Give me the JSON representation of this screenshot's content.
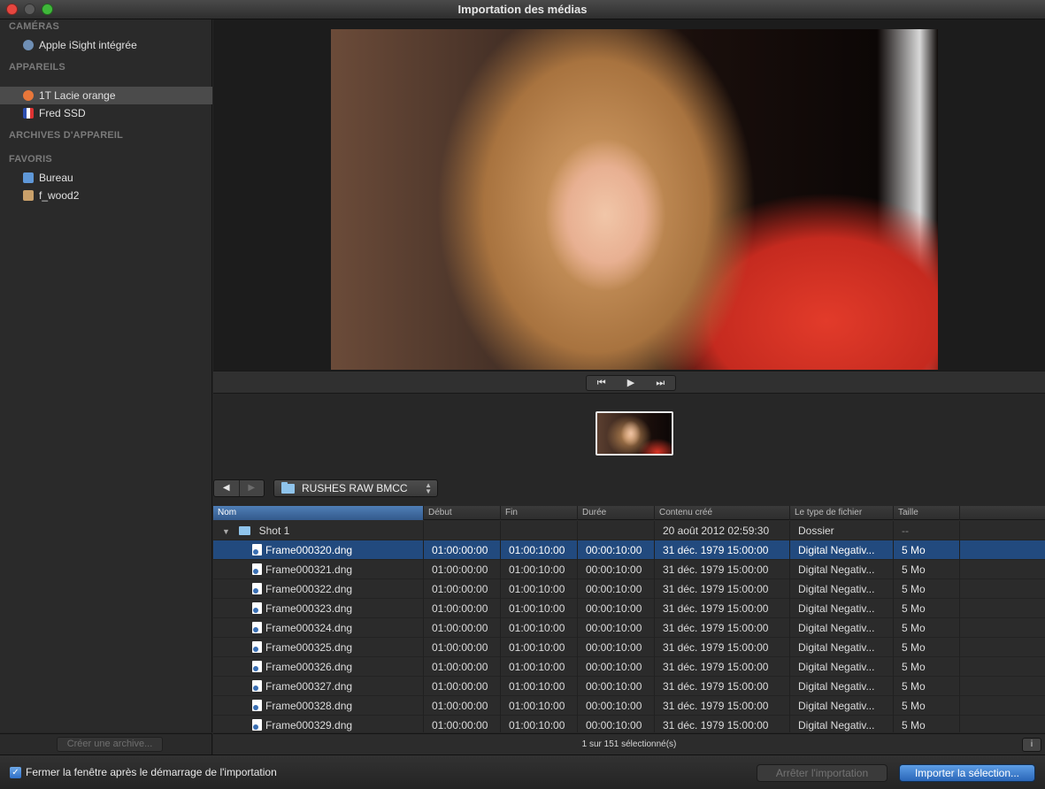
{
  "window": {
    "title": "Importation des médias"
  },
  "sidebar": {
    "sections": [
      {
        "heading": "CAMÉRAS",
        "items": [
          {
            "label": "Apple iSight intégrée",
            "icon": "camera-icon"
          }
        ]
      },
      {
        "heading": "APPAREILS",
        "items": [
          {
            "label": "1T Lacie orange",
            "icon": "drive-icon",
            "selected": true
          },
          {
            "label": "Fred SSD",
            "icon": "french-flag-icon"
          }
        ]
      },
      {
        "heading": "ARCHIVES D'APPAREIL",
        "items": []
      },
      {
        "heading": "FAVORIS",
        "items": [
          {
            "label": "Bureau",
            "icon": "desktop-folder-icon"
          },
          {
            "label": "f_wood2",
            "icon": "home-icon"
          }
        ]
      }
    ],
    "create_archive_label": "Créer une archive..."
  },
  "transport": {
    "prev": "⏮",
    "play": "▶",
    "next": "⏭"
  },
  "path": {
    "back": "◀",
    "forward": "▶",
    "folder": "RUSHES RAW BMCC"
  },
  "table": {
    "columns": [
      "Nom",
      "Début",
      "Fin",
      "Durée",
      "Contenu créé",
      "Le type de fichier",
      "Taille"
    ],
    "group": {
      "name": "Shot 1",
      "created": "20 août 2012 02:59:30",
      "type": "Dossier",
      "size": "--"
    },
    "rows": [
      {
        "name": "Frame000320.dng",
        "start": "01:00:00:00",
        "end": "01:00:10:00",
        "duration": "00:00:10:00",
        "created": "31 déc. 1979 15:00:00",
        "type": "Digital Negativ...",
        "size": "5 Mo",
        "selected": true
      },
      {
        "name": "Frame000321.dng",
        "start": "01:00:00:00",
        "end": "01:00:10:00",
        "duration": "00:00:10:00",
        "created": "31 déc. 1979 15:00:00",
        "type": "Digital Negativ...",
        "size": "5 Mo"
      },
      {
        "name": "Frame000322.dng",
        "start": "01:00:00:00",
        "end": "01:00:10:00",
        "duration": "00:00:10:00",
        "created": "31 déc. 1979 15:00:00",
        "type": "Digital Negativ...",
        "size": "5 Mo"
      },
      {
        "name": "Frame000323.dng",
        "start": "01:00:00:00",
        "end": "01:00:10:00",
        "duration": "00:00:10:00",
        "created": "31 déc. 1979 15:00:00",
        "type": "Digital Negativ...",
        "size": "5 Mo"
      },
      {
        "name": "Frame000324.dng",
        "start": "01:00:00:00",
        "end": "01:00:10:00",
        "duration": "00:00:10:00",
        "created": "31 déc. 1979 15:00:00",
        "type": "Digital Negativ...",
        "size": "5 Mo"
      },
      {
        "name": "Frame000325.dng",
        "start": "01:00:00:00",
        "end": "01:00:10:00",
        "duration": "00:00:10:00",
        "created": "31 déc. 1979 15:00:00",
        "type": "Digital Negativ...",
        "size": "5 Mo"
      },
      {
        "name": "Frame000326.dng",
        "start": "01:00:00:00",
        "end": "01:00:10:00",
        "duration": "00:00:10:00",
        "created": "31 déc. 1979 15:00:00",
        "type": "Digital Negativ...",
        "size": "5 Mo"
      },
      {
        "name": "Frame000327.dng",
        "start": "01:00:00:00",
        "end": "01:00:10:00",
        "duration": "00:00:10:00",
        "created": "31 déc. 1979 15:00:00",
        "type": "Digital Negativ...",
        "size": "5 Mo"
      },
      {
        "name": "Frame000328.dng",
        "start": "01:00:00:00",
        "end": "01:00:10:00",
        "duration": "00:00:10:00",
        "created": "31 déc. 1979 15:00:00",
        "type": "Digital Negativ...",
        "size": "5 Mo"
      },
      {
        "name": "Frame000329.dng",
        "start": "01:00:00:00",
        "end": "01:00:10:00",
        "duration": "00:00:10:00",
        "created": "31 déc. 1979 15:00:00",
        "type": "Digital Negativ...",
        "size": "5 Mo"
      }
    ]
  },
  "status": {
    "text": "1 sur 151 sélectionné(s)",
    "info": "i"
  },
  "footer": {
    "checkbox_label": "Fermer la fenêtre après le démarrage de l'importation",
    "checkbox_checked": true,
    "stop_label": "Arrêter l'importation",
    "import_label": "Importer la sélection..."
  },
  "colors": {
    "accent": "#2a66b8",
    "selection": "#224a7e",
    "background": "#262626"
  }
}
